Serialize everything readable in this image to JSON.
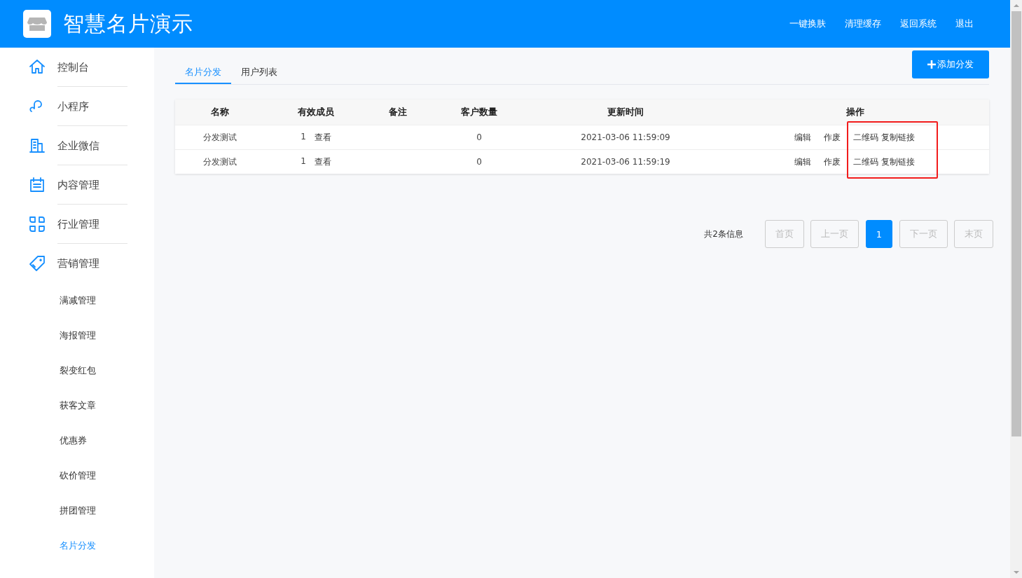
{
  "header": {
    "title": "智慧名片演示",
    "links": [
      "一键换肤",
      "清理缓存",
      "返回系统",
      "退出"
    ]
  },
  "sidebar": {
    "items": [
      {
        "label": "控制台",
        "selected": false
      },
      {
        "label": "小程序",
        "selected": false
      },
      {
        "label": "企业微信",
        "selected": false
      },
      {
        "label": "内容管理",
        "selected": false
      },
      {
        "label": "行业管理",
        "selected": false
      },
      {
        "label": "营销管理",
        "selected": false,
        "children": [
          {
            "label": "满减管理",
            "selected": false
          },
          {
            "label": "海报管理",
            "selected": false
          },
          {
            "label": "裂变红包",
            "selected": false
          },
          {
            "label": "获客文章",
            "selected": false
          },
          {
            "label": "优惠券",
            "selected": false
          },
          {
            "label": "砍价管理",
            "selected": false
          },
          {
            "label": "拼团管理",
            "selected": false
          },
          {
            "label": "名片分发",
            "selected": true
          }
        ]
      }
    ]
  },
  "tabs": [
    {
      "label": "名片分发",
      "selected": true
    },
    {
      "label": "用户列表",
      "selected": false
    }
  ],
  "add_button": "添加分发",
  "table": {
    "columns": [
      "名称",
      "有效成员",
      "备注",
      "客户数量",
      "更新时间",
      "操作"
    ],
    "highlight_actions": true,
    "rows": [
      {
        "name": "分发测试",
        "members": "1",
        "members_link": "查看",
        "customers": "0",
        "updated": "2021-03-06 11:59:09",
        "actions": [
          "编辑",
          "作废",
          "二维码",
          "复制链接"
        ]
      },
      {
        "name": "分发测试",
        "members": "1",
        "members_link": "查看",
        "customers": "0",
        "updated": "2021-03-06 11:59:19",
        "actions": [
          "编辑",
          "作废",
          "二维码",
          "复制链接"
        ]
      }
    ]
  },
  "pagination": {
    "info": "共2条信息",
    "buttons": [
      {
        "label": "首页",
        "kind": "nav",
        "disabled": true
      },
      {
        "label": "上一页",
        "kind": "nav",
        "disabled": true
      },
      {
        "label": "1",
        "kind": "page",
        "selected": true
      },
      {
        "label": "下一页",
        "kind": "nav",
        "disabled": true
      },
      {
        "label": "末页",
        "kind": "nav",
        "disabled": true
      }
    ]
  }
}
